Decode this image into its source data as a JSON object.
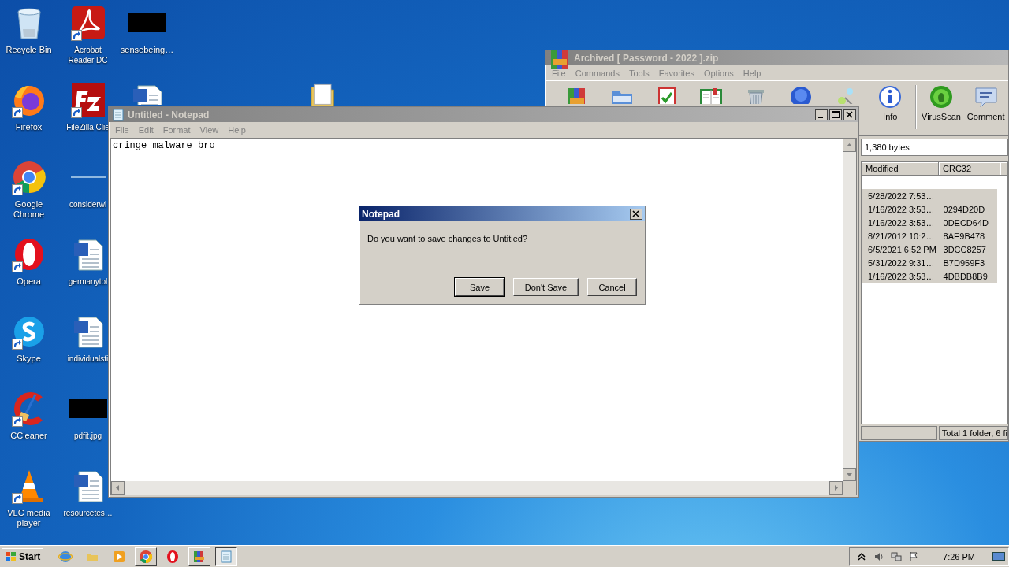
{
  "desktop": {
    "columns": [
      [
        {
          "kind": "bin",
          "label": "Recycle Bin",
          "shortcut": false
        },
        {
          "kind": "fox",
          "label": "Firefox",
          "shortcut": true
        },
        {
          "kind": "chrome",
          "label": "Google Chrome",
          "shortcut": true
        },
        {
          "kind": "opera",
          "label": "Opera",
          "shortcut": true
        },
        {
          "kind": "chat",
          "label": "Skype",
          "shortcut": true
        },
        {
          "kind": "cleaner",
          "label": "CCleaner",
          "shortcut": true
        },
        {
          "kind": "cone",
          "label": "VLC media player",
          "shortcut": true
        }
      ],
      [
        {
          "kind": "pdf",
          "label": "Acrobat Reader DC",
          "shortcut": true
        },
        {
          "kind": "ftp",
          "label": "FileZilla Clie",
          "shortcut": true
        },
        {
          "kind": "blank",
          "label": "considerwi",
          "shortcut": false
        },
        {
          "kind": "doc",
          "label": "germanytol",
          "shortcut": false
        },
        {
          "kind": "doc",
          "label": "individualsti",
          "shortcut": false
        },
        {
          "kind": "image",
          "label": "pdfit.jpg",
          "shortcut": false
        },
        {
          "kind": "doc",
          "label": "resourcetes…",
          "shortcut": false
        }
      ],
      [
        {
          "kind": "image",
          "label": "sensebeing…",
          "shortcut": false
        },
        {
          "kind": "doc",
          "shortcut": false
        }
      ]
    ],
    "loose_icons": [
      {
        "kind": "folder"
      }
    ]
  },
  "archive_window": {
    "title": "Archived [ Password - 2022 ].zip",
    "menu": [
      "File",
      "Commands",
      "Tools",
      "Favorites",
      "Options",
      "Help"
    ],
    "toolbar": [
      {
        "kind": "add"
      },
      {
        "kind": "extract"
      },
      {
        "kind": "test"
      },
      {
        "kind": "view"
      },
      {
        "kind": "delete"
      },
      {
        "kind": "find"
      },
      {
        "kind": "wizard"
      },
      {
        "kind": "info",
        "label": "Info"
      },
      {
        "kind": "scan",
        "label": "VirusScan"
      },
      {
        "kind": "comment",
        "label": "Comment"
      }
    ],
    "address": "1,380 bytes",
    "columns": [
      "Modified",
      "CRC32"
    ],
    "rows": [
      {
        "modified": "5/28/2022 7:53…",
        "crc32": "",
        "selected": true
      },
      {
        "modified": "1/16/2022 3:53…",
        "crc32": "0294D20D",
        "selected": true
      },
      {
        "modified": "1/16/2022 3:53…",
        "crc32": "0DECD64D",
        "selected": true
      },
      {
        "modified": "8/21/2012 10:2…",
        "crc32": "8AE9B478",
        "selected": true
      },
      {
        "modified": "6/5/2021 6:52 PM",
        "crc32": "3DCC8257",
        "selected": true
      },
      {
        "modified": "5/31/2022 9:31…",
        "crc32": "B7D959F3",
        "selected": true
      },
      {
        "modified": "1/16/2022 3:53…",
        "crc32": "4DBDB8B9",
        "selected": true
      }
    ],
    "status": "Total 1 folder, 6 fi"
  },
  "notepad": {
    "title": "Untitled - Notepad",
    "active": false,
    "menu": [
      "File",
      "Edit",
      "Format",
      "View",
      "Help"
    ],
    "text": "cringe malware bro"
  },
  "dialog": {
    "title": "Notepad",
    "message": "Do you want to save changes to Untitled?",
    "buttons": [
      {
        "label": "Save",
        "default": true
      },
      {
        "label": "Don't Save",
        "default": false
      },
      {
        "label": "Cancel",
        "default": false
      }
    ]
  },
  "taskbar": {
    "start": "Start",
    "items": [
      {
        "kind": "ie",
        "open": false,
        "selected": false
      },
      {
        "kind": "explorer",
        "open": false,
        "selected": false
      },
      {
        "kind": "media",
        "open": false,
        "selected": false
      },
      {
        "kind": "chrome",
        "open": true,
        "selected": false
      },
      {
        "kind": "opera",
        "open": false,
        "selected": false
      },
      {
        "kind": "archive",
        "open": true,
        "selected": false
      },
      {
        "kind": "notepad",
        "open": true,
        "selected": true
      }
    ],
    "tray": [
      {
        "kind": "chevron"
      },
      {
        "kind": "speaker"
      },
      {
        "kind": "network"
      },
      {
        "kind": "flag"
      }
    ],
    "time": "7:26 PM"
  }
}
